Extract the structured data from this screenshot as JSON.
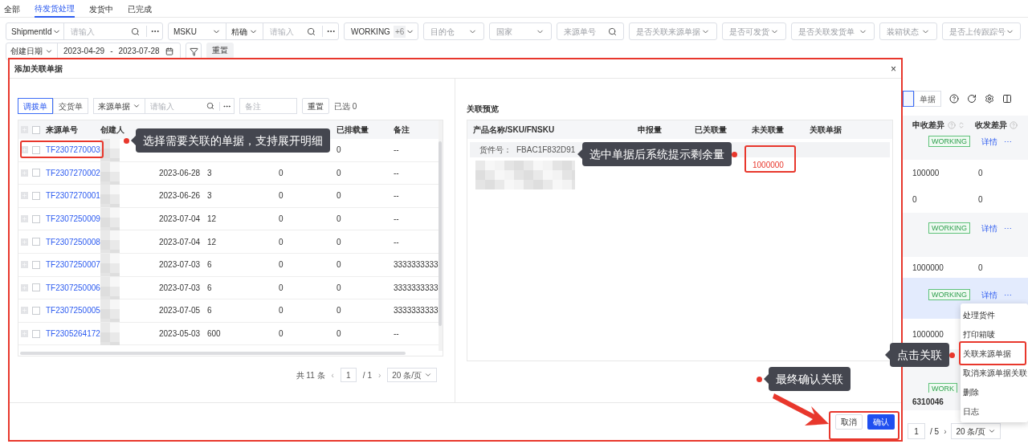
{
  "page_tabs": [
    {
      "label": "全部",
      "selected": false
    },
    {
      "label": "待发货处理",
      "selected": true
    },
    {
      "label": "发货中",
      "selected": false
    },
    {
      "label": "已完成",
      "selected": false
    }
  ],
  "filters": [
    {
      "kind": "combo",
      "select": "ShipmentId",
      "placeholder": "请输入"
    },
    {
      "kind": "combo",
      "select": "MSKU",
      "mode": "精确",
      "placeholder": "请输入"
    },
    {
      "kind": "tags",
      "value": "WORKING",
      "extra": "+6"
    },
    {
      "kind": "select",
      "placeholder": "目的仓"
    },
    {
      "kind": "select",
      "placeholder": "国家"
    },
    {
      "kind": "search",
      "placeholder": "来源单号"
    },
    {
      "kind": "select",
      "placeholder": "是否关联来源单据"
    },
    {
      "kind": "select",
      "placeholder": "是否可发货"
    },
    {
      "kind": "select",
      "placeholder": "是否关联发货单"
    },
    {
      "kind": "select",
      "placeholder": "装箱状态"
    },
    {
      "kind": "select",
      "placeholder": "是否上传跟踪号"
    }
  ],
  "date_filter": {
    "field": "创建日期",
    "start": "2023-04-29",
    "separator": "-",
    "end": "2023-07-28"
  },
  "reset_button": "重置",
  "bg_table": {
    "segments": [
      {
        "selected": true
      },
      {
        "label": "单据",
        "selected": false
      }
    ],
    "columns": [
      "申收差异",
      "收发差异"
    ],
    "blocks": [
      {
        "kind": "status",
        "tag": "WORKING",
        "link": "详情",
        "more": "⋯",
        "highlighted": false
      },
      {
        "kind": "values",
        "cells": [
          "100000",
          "0"
        ]
      },
      {
        "kind": "values",
        "cells": [
          "0",
          "0"
        ]
      },
      {
        "kind": "status",
        "tag": "WORKING",
        "link": "详情",
        "more": "⋯",
        "highlighted": false
      },
      {
        "kind": "values",
        "cells": [
          "1000000",
          "0"
        ]
      },
      {
        "kind": "status",
        "tag": "WORKING",
        "link": "详情",
        "more": "⋯",
        "highlighted": true
      },
      {
        "kind": "values",
        "cells": [
          "1000000"
        ]
      },
      {
        "kind": "status",
        "tag": "WORK",
        "highlighted": false
      }
    ],
    "total": "6310046",
    "pagination": {
      "page": "1",
      "pages": "/ 5",
      "next": "›",
      "page_size": "20 条/页"
    }
  },
  "row_menu": [
    "处理货件",
    "打印箱唛",
    "关联来源单据",
    "取消来源单据关联",
    "删除",
    "日志"
  ],
  "modal": {
    "title": "添加关联单据",
    "close": "×",
    "doc_types": [
      {
        "label": "调拨单",
        "selected": true
      },
      {
        "label": "交货单",
        "selected": false
      }
    ],
    "source_field": {
      "select": "来源单据",
      "placeholder": "请输入"
    },
    "remark_field": {
      "placeholder": "备注"
    },
    "reset": "重置",
    "selected_count": "已选 0",
    "all_checked": false,
    "columns": {
      "id": "来源单号",
      "creator": "创建人",
      "loaded": "已排载量",
      "remark": "备注"
    },
    "rows": [
      {
        "id": "TF2307270003",
        "loaded": "0",
        "remark": "--",
        "checked": false
      },
      {
        "id": "TF2307270002",
        "date": "2023-06-28",
        "qty": "3",
        "shipped": "0",
        "loaded": "0",
        "remark": "--",
        "checked": false
      },
      {
        "id": "TF2307270001",
        "date": "2023-06-26",
        "qty": "3",
        "shipped": "0",
        "loaded": "0",
        "remark": "--",
        "checked": false
      },
      {
        "id": "TF2307250009",
        "date": "2023-07-04",
        "qty": "12",
        "shipped": "0",
        "loaded": "0",
        "remark": "--",
        "checked": false
      },
      {
        "id": "TF2307250008",
        "date": "2023-07-04",
        "qty": "12",
        "shipped": "0",
        "loaded": "0",
        "remark": "--",
        "checked": false
      },
      {
        "id": "TF2307250007",
        "date": "2023-07-03",
        "qty": "6",
        "shipped": "0",
        "loaded": "0",
        "remark": "3333333333",
        "checked": false
      },
      {
        "id": "TF2307250006",
        "date": "2023-07-03",
        "qty": "6",
        "shipped": "0",
        "loaded": "0",
        "remark": "3333333333",
        "checked": false
      },
      {
        "id": "TF2307250005",
        "date": "2023-07-05",
        "qty": "6",
        "shipped": "0",
        "loaded": "0",
        "remark": "3333333333",
        "checked": false
      },
      {
        "id": "TF2305264172",
        "date": "2023-05-03",
        "qty": "600",
        "shipped": "0",
        "loaded": "0",
        "remark": "--",
        "checked": false
      }
    ],
    "pagination": {
      "total": "共 11 条",
      "prev": "‹",
      "page": "1",
      "pages": "/ 1",
      "next": "›",
      "page_size": "20 条/页"
    },
    "preview": {
      "title": "关联预览",
      "columns": [
        "产品名称/SKU/FNSKU",
        "申报量",
        "已关联量",
        "未关联量",
        "关联单据"
      ],
      "group_label": "货件号：",
      "group_value": "FBAC1F832D91",
      "unlinked": "1000000"
    },
    "cancel": "取消",
    "confirm": "确认"
  },
  "callouts": [
    "选择需要关联的单据，支持展开明细",
    "选中单据后系统提示剩余量",
    "点击关联",
    "最终确认关联"
  ]
}
